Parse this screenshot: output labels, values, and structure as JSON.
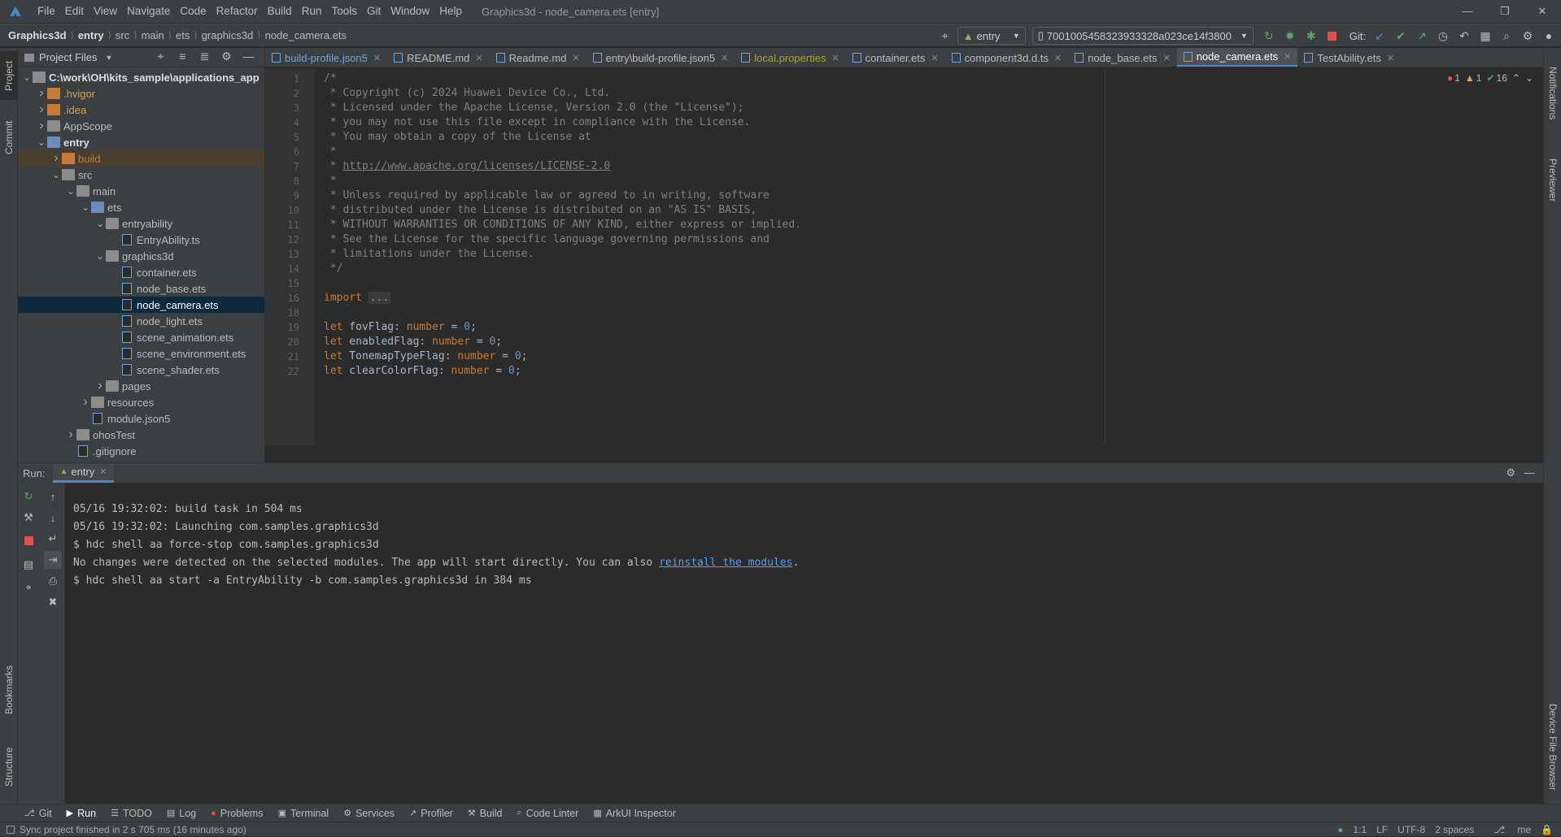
{
  "menu": [
    "File",
    "Edit",
    "View",
    "Navigate",
    "Code",
    "Refactor",
    "Build",
    "Run",
    "Tools",
    "Git",
    "Window",
    "Help"
  ],
  "window_title": "Graphics3d - node_camera.ets [entry]",
  "breadcrumbs": [
    "Graphics3d",
    "entry",
    "src",
    "main",
    "ets",
    "graphics3d",
    "node_camera.ets"
  ],
  "toolbar": {
    "run_config": "entry",
    "device": "7001005458323933328a023ce14f3800",
    "git_label": "Git:"
  },
  "left_strip": [
    "Project",
    "Commit",
    "Bookmarks",
    "Structure"
  ],
  "right_strip": [
    "Notifications",
    "Previewer",
    "Device File Browser"
  ],
  "project": {
    "header": "Project Files",
    "tree": [
      {
        "label": "C:\\work\\OH\\kits_sample\\applications_app",
        "depth": 0,
        "type": "folder",
        "open": true,
        "bold": true
      },
      {
        "label": ".hvigor",
        "depth": 1,
        "type": "folder-orange",
        "open": false,
        "color": "#d4a04a"
      },
      {
        "label": ".idea",
        "depth": 1,
        "type": "folder-orange",
        "open": false,
        "color": "#d4a04a"
      },
      {
        "label": "AppScope",
        "depth": 1,
        "type": "folder",
        "open": false
      },
      {
        "label": "entry",
        "depth": 1,
        "type": "folder-blue",
        "open": true,
        "bold": true
      },
      {
        "label": "build",
        "depth": 2,
        "type": "folder-orange",
        "open": false,
        "color": "#c67c38",
        "hl": true
      },
      {
        "label": "src",
        "depth": 2,
        "type": "folder",
        "open": true
      },
      {
        "label": "main",
        "depth": 3,
        "type": "folder",
        "open": true
      },
      {
        "label": "ets",
        "depth": 4,
        "type": "folder-blue",
        "open": true
      },
      {
        "label": "entryability",
        "depth": 5,
        "type": "folder",
        "open": true
      },
      {
        "label": "EntryAbility.ts",
        "depth": 6,
        "type": "file"
      },
      {
        "label": "graphics3d",
        "depth": 5,
        "type": "folder",
        "open": true
      },
      {
        "label": "container.ets",
        "depth": 6,
        "type": "file"
      },
      {
        "label": "node_base.ets",
        "depth": 6,
        "type": "file"
      },
      {
        "label": "node_camera.ets",
        "depth": 6,
        "type": "file",
        "selected": true
      },
      {
        "label": "node_light.ets",
        "depth": 6,
        "type": "file"
      },
      {
        "label": "scene_animation.ets",
        "depth": 6,
        "type": "file"
      },
      {
        "label": "scene_environment.ets",
        "depth": 6,
        "type": "file"
      },
      {
        "label": "scene_shader.ets",
        "depth": 6,
        "type": "file"
      },
      {
        "label": "pages",
        "depth": 5,
        "type": "folder",
        "open": false
      },
      {
        "label": "resources",
        "depth": 4,
        "type": "folder",
        "open": false
      },
      {
        "label": "module.json5",
        "depth": 4,
        "type": "file"
      },
      {
        "label": "ohosTest",
        "depth": 3,
        "type": "folder",
        "open": false
      },
      {
        "label": ".gitignore",
        "depth": 3,
        "type": "file"
      }
    ]
  },
  "tabs": [
    {
      "label": "build-profile.json5",
      "color": "#6fa3d6"
    },
    {
      "label": "README.md"
    },
    {
      "label": "Readme.md"
    },
    {
      "label": "entry\\build-profile.json5"
    },
    {
      "label": "local.properties",
      "color": "#a6a61f"
    },
    {
      "label": "container.ets"
    },
    {
      "label": "component3d.d.ts"
    },
    {
      "label": "node_base.ets"
    },
    {
      "label": "node_camera.ets",
      "active": true
    },
    {
      "label": "TestAbility.ets"
    }
  ],
  "inspections": {
    "errors": "1",
    "warnings": "1",
    "ok": "16"
  },
  "code_lines": [
    {
      "n": "1",
      "html": "<span class='cm'>/*</span>"
    },
    {
      "n": "2",
      "html": "<span class='cm'> * Copyright (c) 2024 Huawei Device Co., Ltd.</span>"
    },
    {
      "n": "3",
      "html": "<span class='cm'> * Licensed under the Apache License, Version 2.0 (the \"License\");</span>"
    },
    {
      "n": "4",
      "html": "<span class='cm'> * you may not use this file except in compliance with the License.</span>"
    },
    {
      "n": "5",
      "html": "<span class='cm'> * You may obtain a copy of the License at</span>"
    },
    {
      "n": "6",
      "html": "<span class='cm'> *</span>"
    },
    {
      "n": "7",
      "html": "<span class='cm'> * </span><span class='url'>http://www.apache.org/licenses/LICENSE-2.0</span>"
    },
    {
      "n": "8",
      "html": "<span class='cm'> *</span>"
    },
    {
      "n": "9",
      "html": "<span class='cm'> * Unless required by applicable law or agreed to in writing, software</span>"
    },
    {
      "n": "10",
      "html": "<span class='cm'> * distributed under the License is distributed on an \"AS IS\" BASIS,</span>"
    },
    {
      "n": "11",
      "html": "<span class='cm'> * WITHOUT WARRANTIES OR CONDITIONS OF ANY KIND, either express or implied.</span>"
    },
    {
      "n": "12",
      "html": "<span class='cm'> * See the License for the specific language governing permissions and</span>"
    },
    {
      "n": "13",
      "html": "<span class='cm'> * limitations under the License.</span>"
    },
    {
      "n": "14",
      "html": "<span class='cm'> */</span>"
    },
    {
      "n": "15",
      "html": ""
    },
    {
      "n": "16",
      "html": "<span class='kw'>import</span> <span class='fold'>...</span>"
    },
    {
      "n": "18",
      "html": ""
    },
    {
      "n": "19",
      "html": "<span class='kw'>let</span> fovFlag: <span class='ty'>number</span> = <span class='num'>0</span>;"
    },
    {
      "n": "20",
      "html": "<span class='kw'>let</span> enabledFlag: <span class='ty'>number</span> = <span class='num'>0</span>;"
    },
    {
      "n": "21",
      "html": "<span class='kw'>let</span> TonemapTypeFlag: <span class='ty'>number</span> = <span class='num'>0</span>;"
    },
    {
      "n": "22",
      "html": "<span class='kw'>let</span> clearColorFlag: <span class='ty'>number</span> = <span class='num'>0</span>;"
    }
  ],
  "run": {
    "label": "Run:",
    "tab": "entry",
    "console": [
      "05/16 19:32:02: build task in 504 ms",
      "05/16 19:32:02: Launching com.samples.graphics3d",
      "$ hdc shell aa force-stop com.samples.graphics3d",
      {
        "pre": "No changes were detected on the selected modules. The app will start directly. You can also ",
        "link": "reinstall the modules",
        "post": "."
      },
      "$ hdc shell aa start -a EntryAbility -b com.samples.graphics3d in 384 ms"
    ]
  },
  "bottom_tools": [
    "Git",
    "Run",
    "TODO",
    "Log",
    "Problems",
    "Terminal",
    "Services",
    "Profiler",
    "Build",
    "Code Linter",
    "ArkUI Inspector"
  ],
  "status": {
    "message": "Sync project finished in 2 s 705 ms (16 minutes ago)",
    "position": "1:1",
    "line_sep": "LF",
    "encoding": "UTF-8",
    "indent": "2 spaces",
    "branch": "me"
  }
}
